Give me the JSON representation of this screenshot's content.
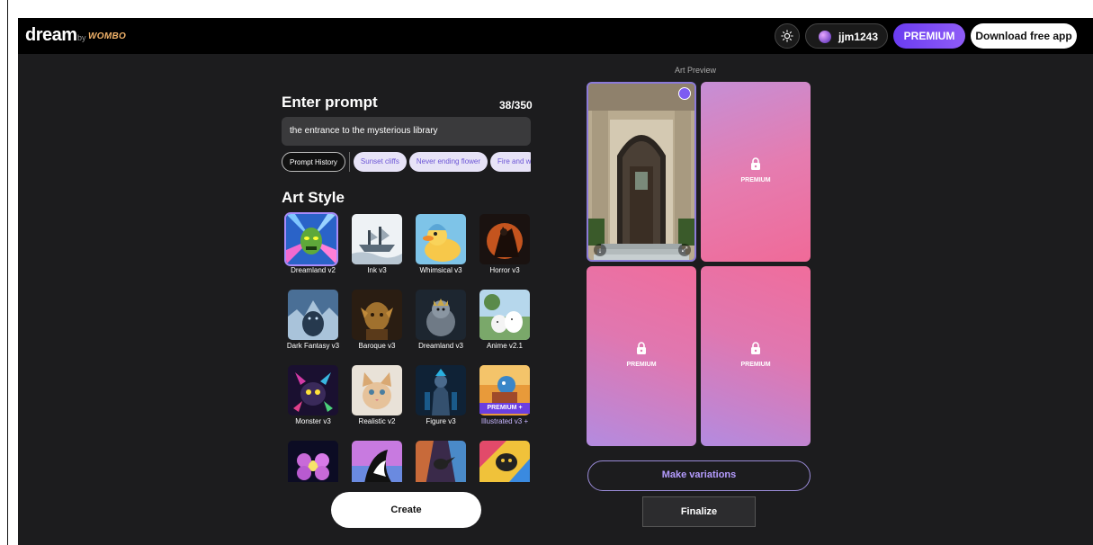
{
  "header": {
    "logo": "dream",
    "logo_by": "by",
    "logo_wombo": "WOMBO",
    "theme_icon": "sun-icon",
    "username": "jjm1243",
    "premium_label": "PREMIUM",
    "download_label": "Download free app"
  },
  "prompt": {
    "title": "Enter prompt",
    "count": "38/350",
    "value": "the entrance to the mysterious library",
    "history_label": "Prompt History",
    "suggestions": [
      "Sunset cliffs",
      "Never ending flower",
      "Fire and w"
    ]
  },
  "art_style": {
    "title": "Art Style",
    "selected": "Dreamland v2",
    "styles": [
      {
        "label": "Dreamland v2"
      },
      {
        "label": "Ink v3"
      },
      {
        "label": "Whimsical v3"
      },
      {
        "label": "Horror v3"
      },
      {
        "label": "Dark Fantasy v3"
      },
      {
        "label": "Baroque v3"
      },
      {
        "label": "Dreamland v3"
      },
      {
        "label": "Anime v2.1"
      },
      {
        "label": "Monster v3"
      },
      {
        "label": "Realistic v2"
      },
      {
        "label": "Figure v3"
      },
      {
        "label": "Illustrated v3 +",
        "tag": "PREMIUM +"
      }
    ]
  },
  "create_label": "Create",
  "preview": {
    "title": "Art Preview",
    "locked_label": "PREMIUM"
  },
  "make_variations_label": "Make variations",
  "finalize_label": "Finalize"
}
